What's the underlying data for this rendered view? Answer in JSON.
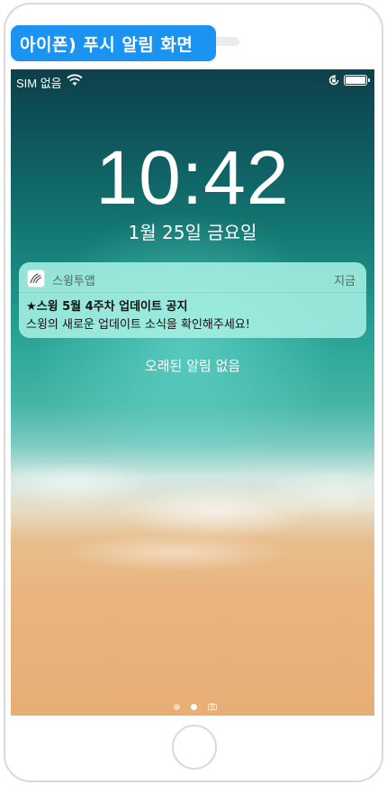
{
  "caption": "아이폰) 푸시 알림 화면",
  "status_bar": {
    "carrier": "SIM 없음",
    "wifi_icon": "wifi-icon",
    "rotation_lock_icon": "rotation-lock-icon",
    "battery_icon": "battery-icon"
  },
  "lock_screen": {
    "time": "10:42",
    "date": "1월 25일 금요일",
    "no_older_notifications": "오래된 알림 없음"
  },
  "notification": {
    "app_icon": "swing-app-icon",
    "app_name": "스윙투앱",
    "time": "지금",
    "title": "★스윙 5월 4주차 업데이트 공지",
    "body": "스윙의 새로운 업데이트 소식을 확인해주세요!"
  },
  "page_indicator": {
    "pages": 3,
    "active_index": 1,
    "camera_icon": "camera-icon"
  },
  "colors": {
    "caption_badge": "#1a93f2",
    "notification_bg": "#a5f0e4"
  }
}
